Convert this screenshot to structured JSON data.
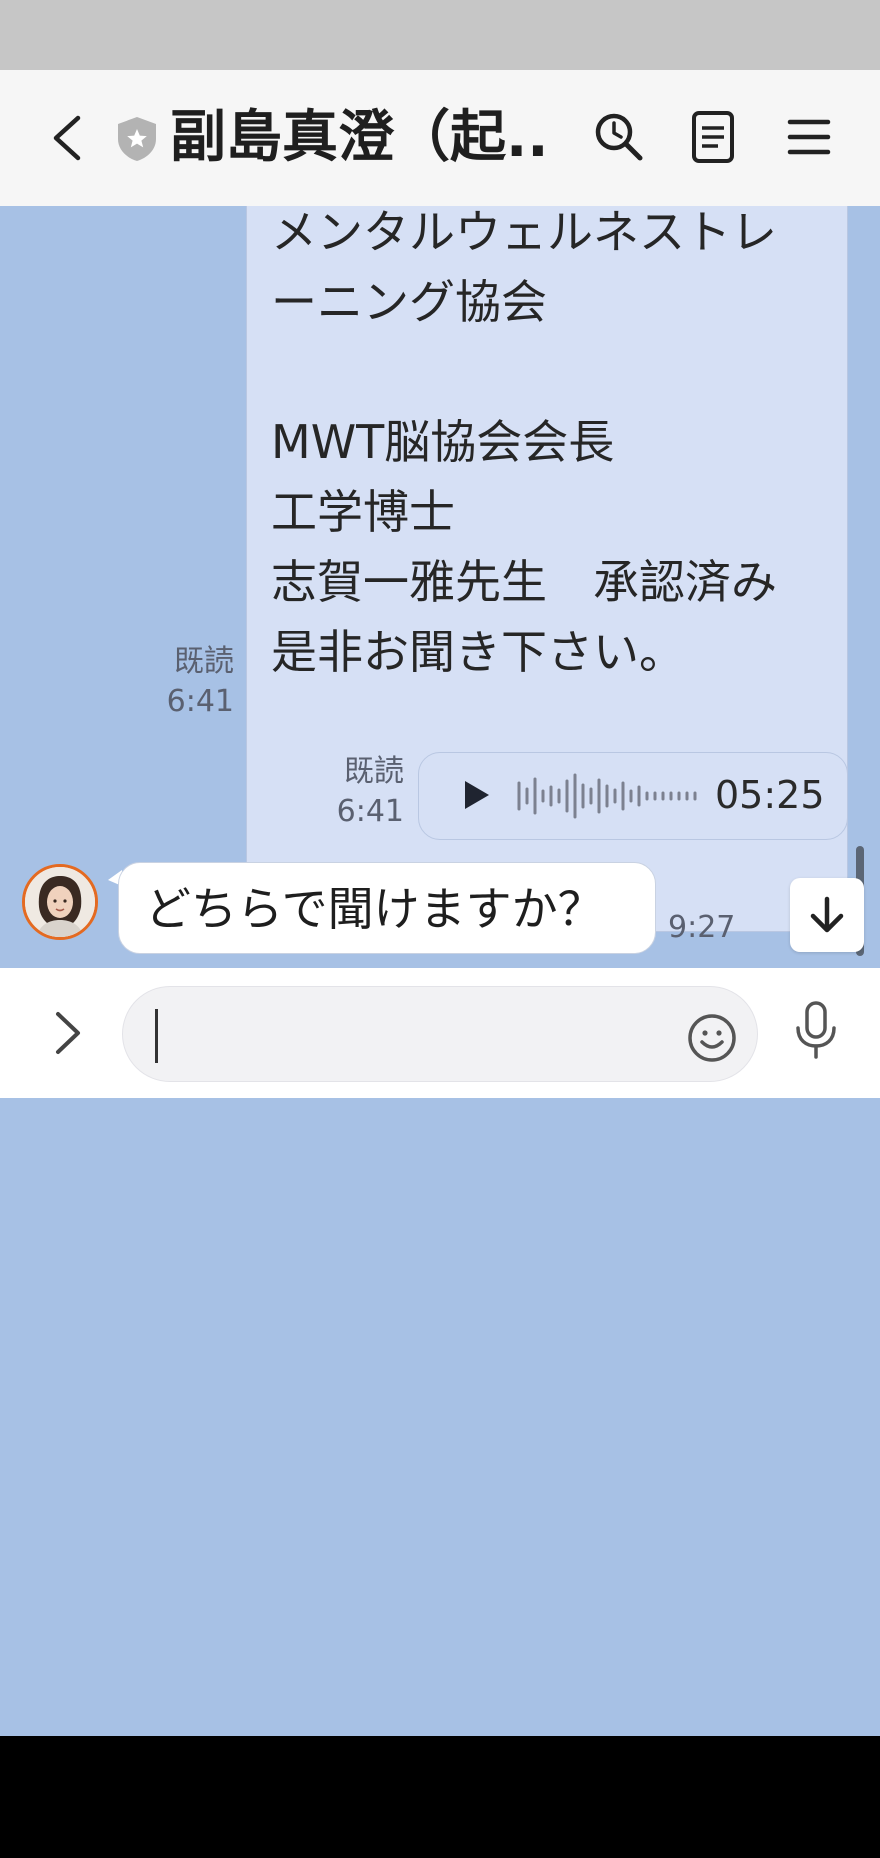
{
  "header": {
    "title": "副島真澄（起...",
    "back_icon": "chevron-left-icon",
    "official_badge_icon": "shield-star-icon",
    "search_icon": "search-icon",
    "notes_icon": "notes-icon",
    "menu_icon": "hamburger-menu-icon"
  },
  "messages": {
    "sent_text": {
      "lines": [
        "メンタルウェルネストレ",
        "ーニング協会",
        "",
        "MWT脳協会会長",
        "工学博士",
        "志賀一雅先生　承認済み",
        "是非お聞き下さい。"
      ],
      "read_label": "既読",
      "time": "6:41"
    },
    "sent_audio": {
      "duration": "05:25",
      "read_label": "既読",
      "time": "6:41",
      "play_icon": "play-icon"
    },
    "received": {
      "text": "どちらで聞けますか？",
      "time": "9:27"
    }
  },
  "input": {
    "placeholder": "",
    "value": "",
    "expand_icon": "chevron-right-icon",
    "emoji_icon": "smiley-icon",
    "mic_icon": "microphone-icon"
  },
  "jump_icon": "arrow-down-icon",
  "colors": {
    "chat_background": "#a7c1e5",
    "sent_bubble": "#d6e0f5",
    "received_bubble": "#ffffff",
    "avatar_ring": "#e46a21"
  }
}
